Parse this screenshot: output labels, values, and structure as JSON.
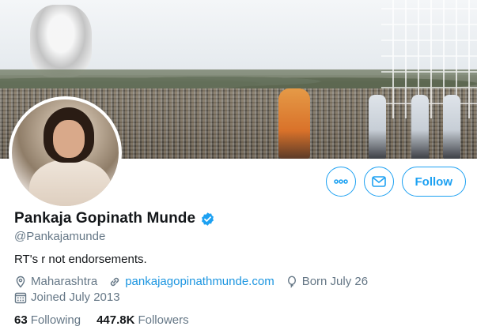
{
  "profile": {
    "name": "Pankaja Gopinath Munde",
    "handle": "@Pankajamunde",
    "bio": "RT's r not endorsements.",
    "verified": true,
    "location": "Maharashtra",
    "website": "pankajagopinathmunde.com",
    "birthday": "Born July 26",
    "joined": "Joined July 2013"
  },
  "actions": {
    "more_icon": "more-dots-icon",
    "message_icon": "envelope-icon",
    "follow_label": "Follow"
  },
  "stats": {
    "following_count": "63",
    "following_label": "Following",
    "followers_count": "447.8K",
    "followers_label": "Followers"
  },
  "colors": {
    "accent": "#1da1f2",
    "link": "#1b95e0",
    "secondary_text": "#657786",
    "primary_text": "#14171a"
  }
}
